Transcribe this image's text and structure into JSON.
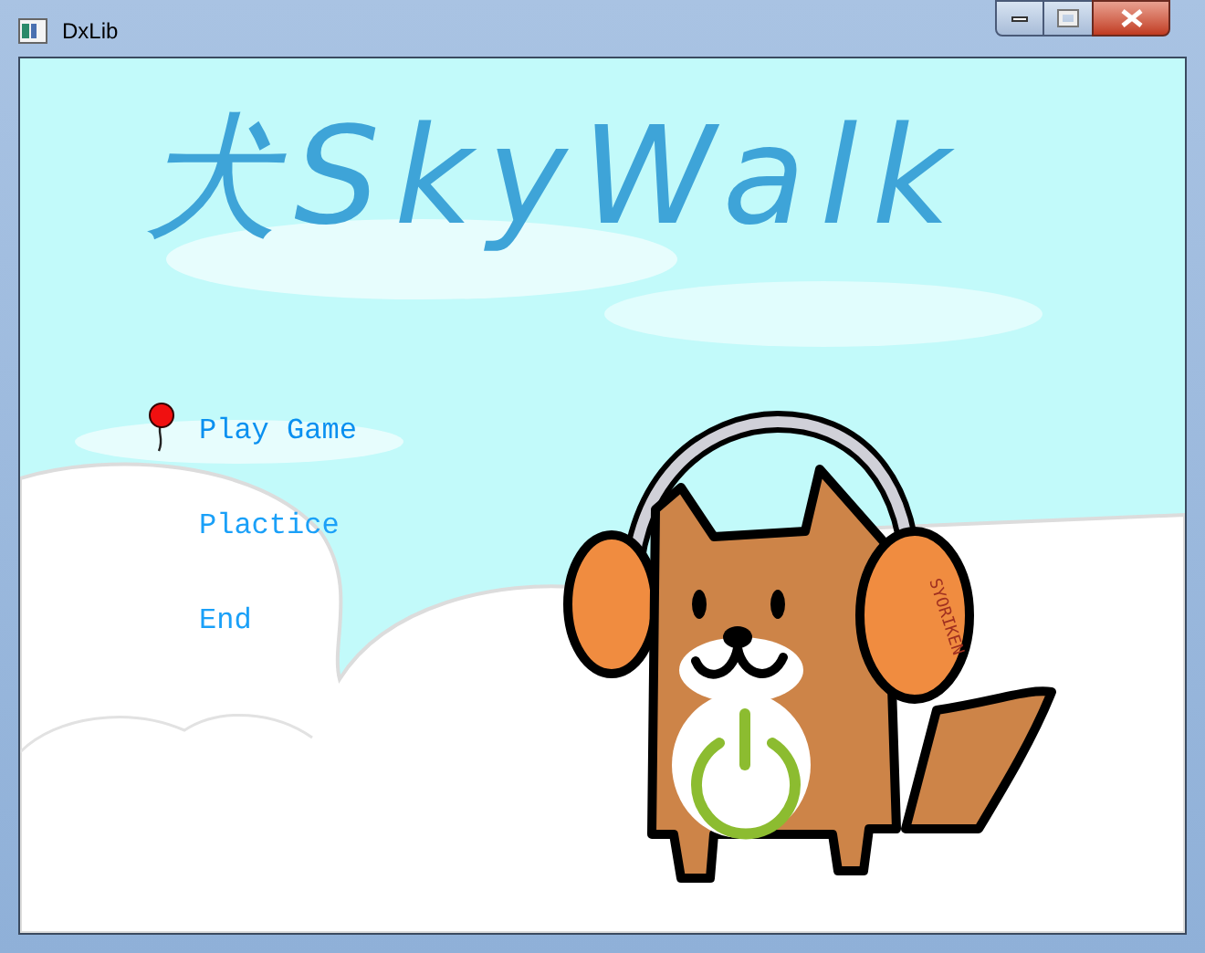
{
  "window": {
    "title": "DxLib"
  },
  "logo": {
    "text": "犬SkyWalk"
  },
  "menu": [
    {
      "label": "Play Game",
      "selected": true
    },
    {
      "label": "Plactice",
      "selected": false
    },
    {
      "label": "End",
      "selected": false
    }
  ],
  "mascot": {
    "earcup_text": "SYORIKEN"
  }
}
